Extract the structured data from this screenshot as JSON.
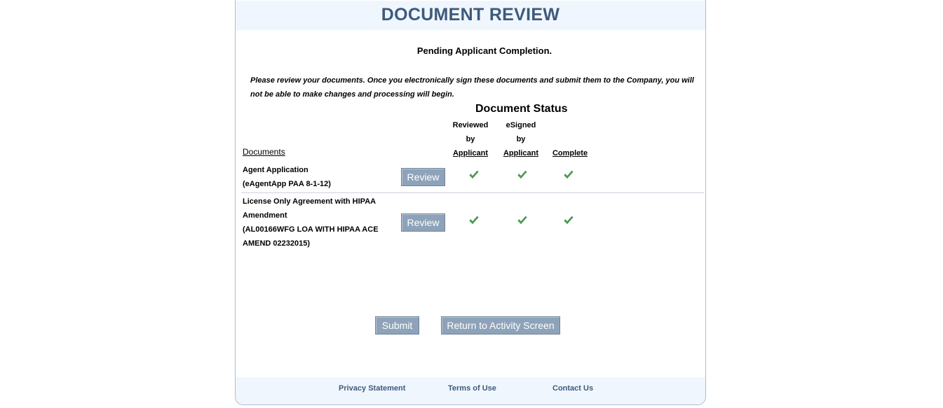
{
  "header": {
    "title": "DOCUMENT REVIEW"
  },
  "status_message": "Pending Applicant Completion.",
  "instructions": "Please review your documents. Once you electronically sign these documents and submit them to the Company, you will not be able to make changes and processing will begin.",
  "document_status_heading": "Document Status",
  "columns": {
    "reviewed": [
      "Reviewed",
      "by",
      "Applicant"
    ],
    "esigned": [
      "eSigned",
      "by",
      "Applicant"
    ],
    "complete": "Complete"
  },
  "documents_label": "Documents",
  "documents": [
    {
      "name_lines": [
        "Agent Application",
        "(eAgentApp PAA 8-1-12)"
      ],
      "review_label": "Review",
      "reviewed": true,
      "esigned": true,
      "complete": true
    },
    {
      "name_lines": [
        "License Only Agreement with HIPAA",
        "Amendment",
        "(AL00166WFG LOA WITH HIPAA ACE",
        "AMEND 02232015)"
      ],
      "review_label": "Review",
      "reviewed": true,
      "esigned": true,
      "complete": true
    }
  ],
  "actions": {
    "submit_label": "Submit",
    "return_label": "Return to Activity Screen"
  },
  "footer": {
    "privacy": "Privacy Statement",
    "terms": "Terms of Use",
    "contact": "Contact Us"
  },
  "colors": {
    "title": "#3d5a7c",
    "button": "#8ea3b9",
    "check": "#4caf50",
    "band": "#f0f6fd"
  }
}
